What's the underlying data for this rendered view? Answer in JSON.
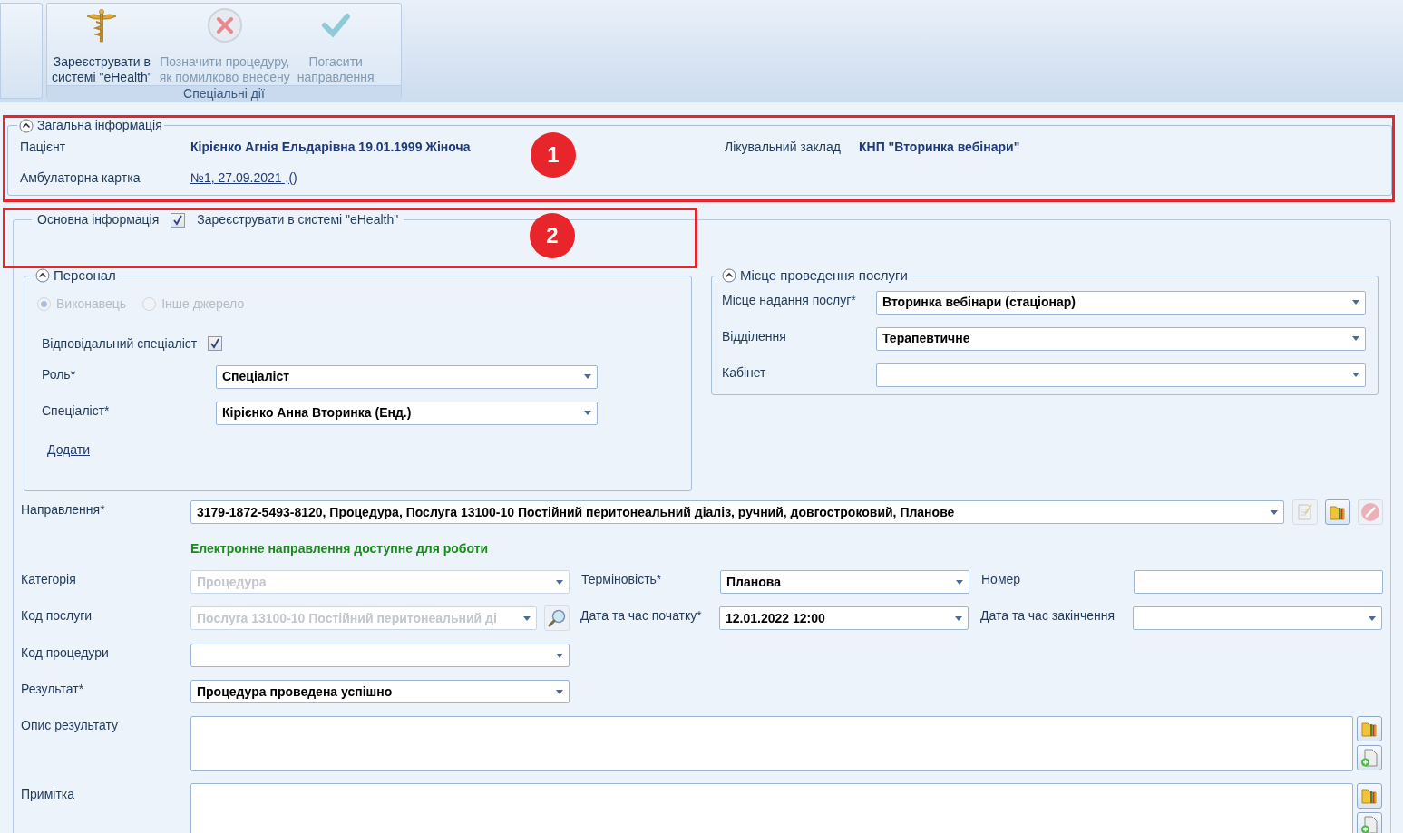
{
  "ribbon": {
    "groups": [
      {
        "label": "Спеціальні дії",
        "buttons": [
          {
            "lines": [
              "Зареєструвати в",
              "системі \"eHealth\""
            ],
            "kind": "caduceus",
            "disabled": false
          },
          {
            "lines": [
              "Позначити процедуру,",
              "як помилково внесену"
            ],
            "kind": "cross",
            "disabled": true
          },
          {
            "lines": [
              "Погасити",
              "направлення"
            ],
            "kind": "check",
            "disabled": true
          }
        ]
      }
    ]
  },
  "general_info": {
    "title": "Загальна інформація",
    "expanded": true,
    "patient": {
      "label": "Пацієнт",
      "value": "Кірієнко Агнія Ельдарівна 19.01.1999 Жіноча"
    },
    "card": {
      "label": "Амбулаторна картка",
      "value": "№1, 27.09.2021 ,()"
    },
    "facility": {
      "label": "Лікувальний заклад",
      "value": "КНП \"Вторинка вебінари\""
    }
  },
  "main_info": {
    "title": "Основна інформація",
    "register": {
      "label": "Зареєструвати в системі \"eHealth\"",
      "checked": true
    }
  },
  "personnel": {
    "title": "Персонал",
    "expanded": true,
    "sources": [
      {
        "label": "Виконавець",
        "selected": true,
        "disabled": true
      },
      {
        "label": "Інше джерело",
        "selected": false,
        "disabled": true
      }
    ],
    "responsible": {
      "label": "Відповідальний спеціаліст",
      "checked": true
    },
    "role": {
      "label": "Роль*",
      "value": "Спеціаліст"
    },
    "specialist": {
      "label": "Спеціаліст*",
      "value": "Кірієнко Анна Вторинка (Енд.)"
    },
    "add_link": "Додати"
  },
  "location": {
    "title": "Місце проведення послуги",
    "expanded": true,
    "fields": [
      {
        "label": "Місце надання послуг*",
        "value": "Вторинка вебінари (стаціонар)"
      },
      {
        "label": "Відділення",
        "value": "Терапевтичне"
      },
      {
        "label": "Кабінет"
      }
    ]
  },
  "referral": {
    "label": "Направлення*",
    "value": "3179-1872-5493-8120, Процедура, Послуга 13100-10 Постійний перитонеальний діаліз, ручний, довгостроковий, Планове",
    "status": "Електронне направлення доступне для роботи"
  },
  "details": {
    "category": {
      "label": "Категорія",
      "value": "Процедура",
      "disabled": true
    },
    "urgency": {
      "label": "Терміновість*",
      "value": "Планова"
    },
    "number": {
      "label": "Номер"
    },
    "service_code": {
      "label": "Код послуги",
      "value": "Послуга 13100-10 Постійний перитонеальний ді",
      "disabled": true
    },
    "start": {
      "label": "Дата та час початку*",
      "value": "12.01.2022 12:00"
    },
    "end": {
      "label": "Дата та час закінчення"
    },
    "procedure_code": {
      "label": "Код процедури"
    },
    "result": {
      "label": "Результат*",
      "value": "Процедура проведена успішно"
    },
    "result_description": {
      "label": "Опис результату"
    },
    "note": {
      "label": "Примітка"
    }
  },
  "annotations": [
    {
      "number": "1"
    },
    {
      "number": "2"
    }
  ]
}
